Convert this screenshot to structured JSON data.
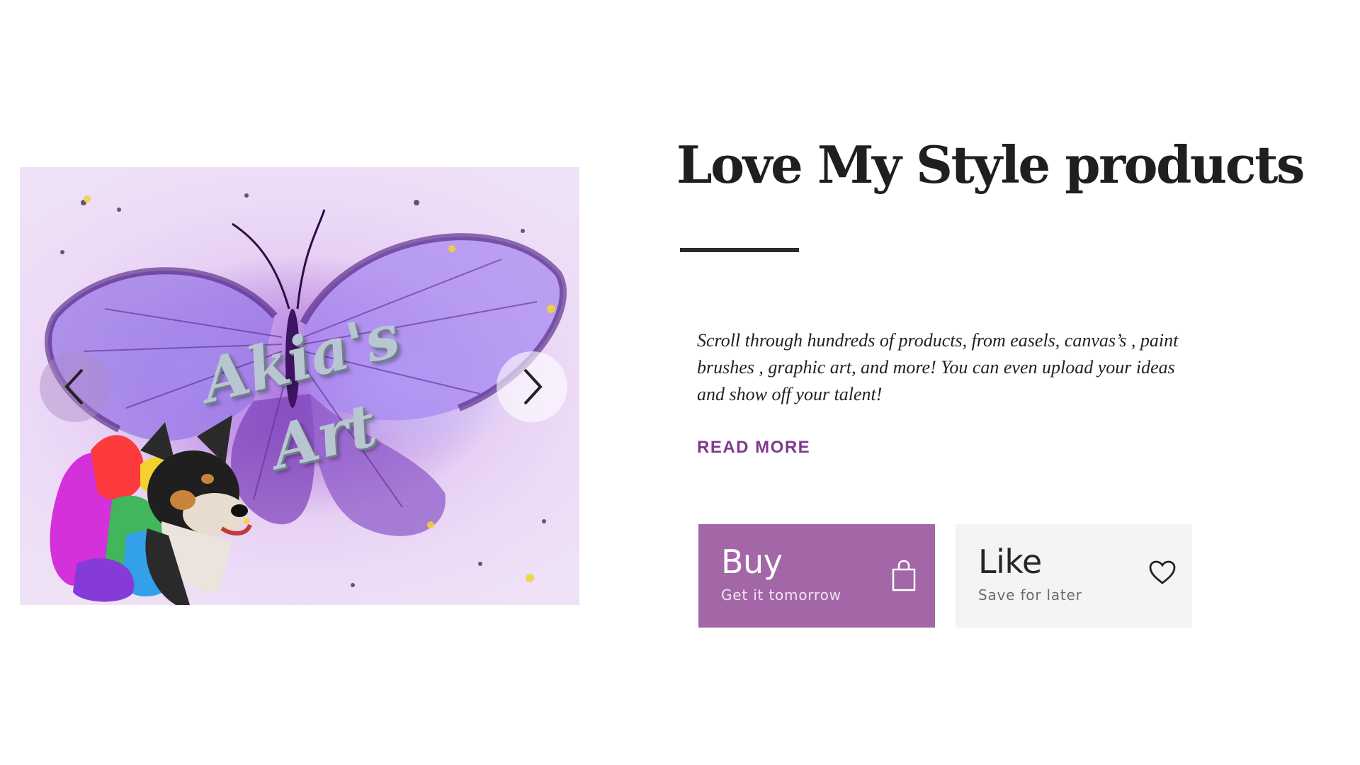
{
  "carousel": {
    "image_text_line1": "Akia's",
    "image_text_line2": "Art",
    "prev_icon": "chevron-left-icon",
    "next_icon": "chevron-right-icon"
  },
  "content": {
    "title": "Love My Style products",
    "description": "Scroll through hundreds of products, from easels, canvas’s , paint brushes , graphic art, and more!  You can even upload your  ideas  and show off your talent!",
    "read_more": "READ MORE"
  },
  "actions": {
    "buy": {
      "title": "Buy",
      "subtitle": "Get it tomorrow",
      "icon": "shopping-bag-icon",
      "color": "#a366a7"
    },
    "like": {
      "title": "Like",
      "subtitle": "Save for later",
      "icon": "heart-icon",
      "color": "#f4f4f4"
    }
  },
  "colors": {
    "accent": "#7d3a8e",
    "title": "#1f1f1f"
  }
}
